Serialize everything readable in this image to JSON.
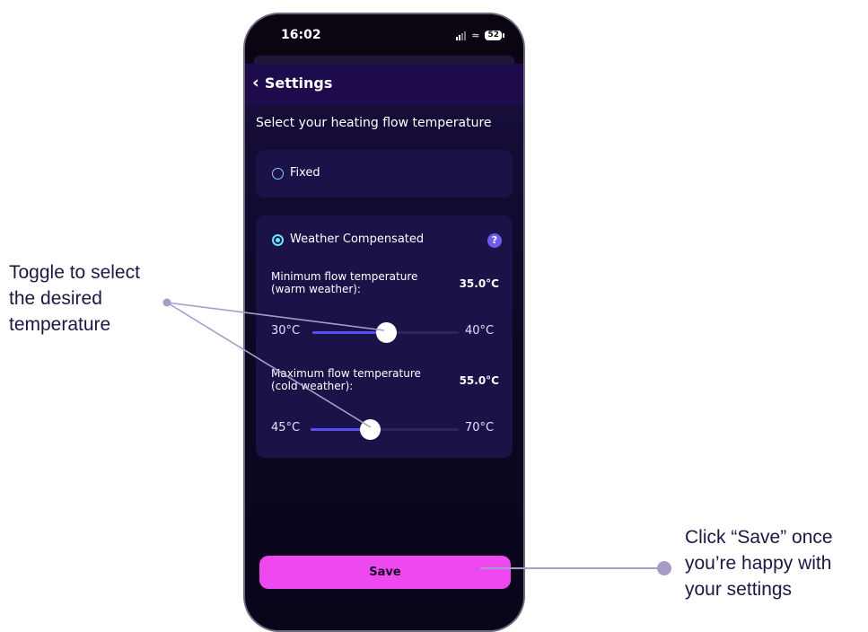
{
  "status_bar": {
    "time": "16:02",
    "battery": "52"
  },
  "header": {
    "back_label": "Settings"
  },
  "heading": "Select your heating flow temperature",
  "options": {
    "fixed": {
      "label": "Fixed",
      "selected": false
    },
    "weather": {
      "label": "Weather Compensated",
      "selected": true,
      "help_symbol": "?"
    }
  },
  "min_flow": {
    "label_line1": "Minimum flow temperature",
    "label_line2": "(warm weather):",
    "value": "35.0°C",
    "range_min": "30°C",
    "range_max": "40°C",
    "fraction": 0.5
  },
  "max_flow": {
    "label_line1": "Maximum flow temperature",
    "label_line2": "(cold weather):",
    "value": "55.0°C",
    "range_min": "45°C",
    "range_max": "70°C",
    "fraction": 0.4
  },
  "save_label": "Save",
  "callouts": {
    "toggle": [
      "Toggle to select",
      "the desired",
      "temperature"
    ],
    "save": [
      "Click “Save” once",
      "you’re happy with",
      "your settings"
    ]
  },
  "colors": {
    "accent": "#5a4df2",
    "save_button": "#ee49f0",
    "radio": "#63e6ff",
    "annotation": "#a79cc8"
  },
  "icons": {
    "back": "chevron-left-icon",
    "help": "help-icon",
    "signal": "signal-icon",
    "wifi": "wifi-icon",
    "battery": "battery-icon"
  }
}
